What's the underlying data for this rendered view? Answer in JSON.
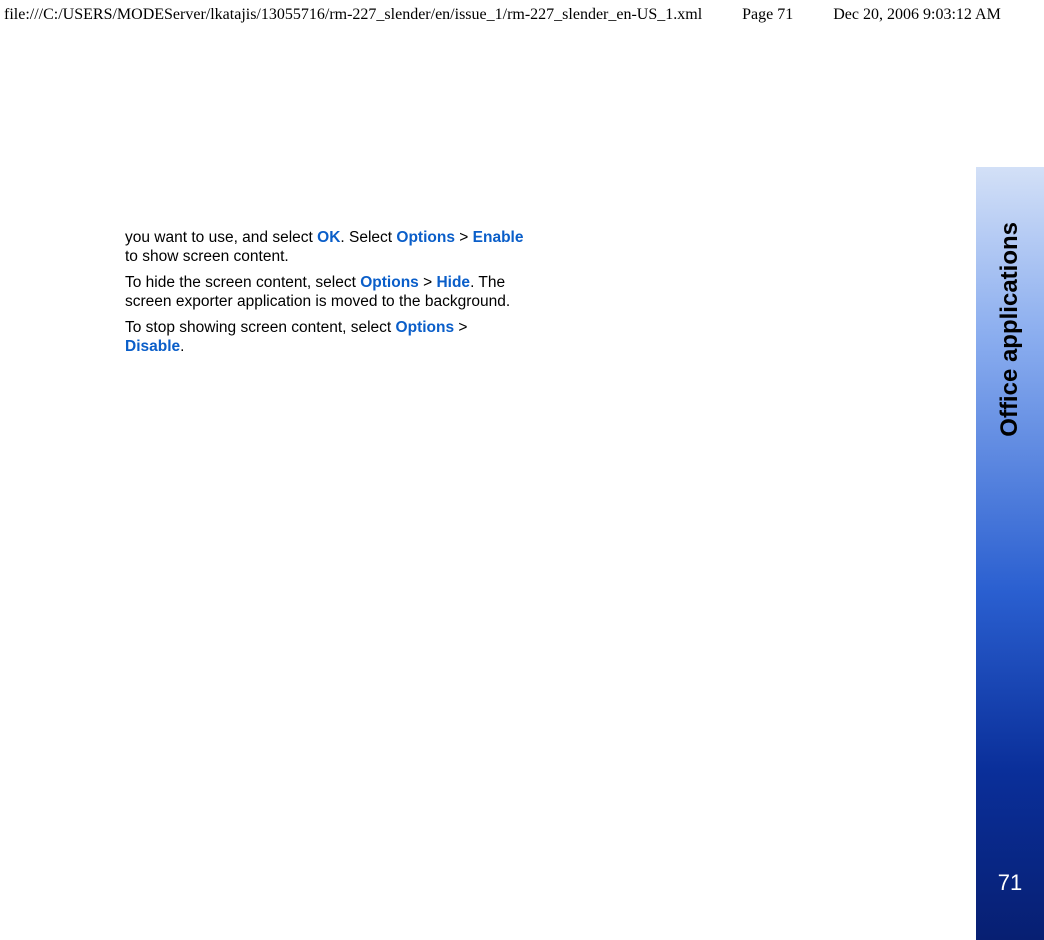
{
  "header": {
    "path": "file:///C:/USERS/MODEServer/lkatajis/13055716/rm-227_slender/en/issue_1/rm-227_slender_en-US_1.xml",
    "page": "Page 71",
    "date": "Dec 20, 2006 9:03:12 AM"
  },
  "body": {
    "p1_a": "you want to use, and select ",
    "p1_ok": "OK",
    "p1_b": ". Select ",
    "p1_options": "Options",
    "p1_gt": " > ",
    "p1_enable": "Enable",
    "p1_c": " to show screen content.",
    "p2_a": "To hide the screen content, select ",
    "p2_options": "Options",
    "p2_gt": " > ",
    "p2_hide": "Hide",
    "p2_b": ". The screen exporter application is moved to the background.",
    "p3_a": "To stop showing screen content, select ",
    "p3_options": "Options",
    "p3_gt": " > ",
    "p3_disable": "Disable",
    "p3_b": "."
  },
  "side": {
    "section": "Office applications",
    "pagenum": "71"
  }
}
